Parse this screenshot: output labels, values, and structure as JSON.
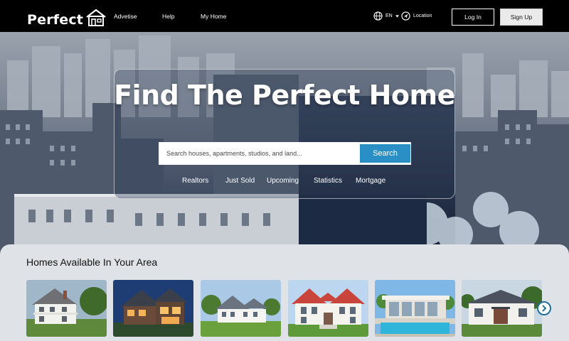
{
  "navbar": {
    "logo_text": "Perfect",
    "links": {
      "advertise": "Advetise",
      "help": "Help",
      "my_home": "My Home"
    },
    "language": "EN",
    "location": "Location",
    "login": "Log In",
    "signup": "Sign Up"
  },
  "hero": {
    "title": "Find The Perfect Home",
    "search_placeholder": "Search houses, apartments, studios, and land...",
    "search_button": "Search",
    "quick_links": {
      "realtors": "Realtors",
      "just_sold": "Just Sold",
      "upcoming": "Upcoming",
      "statistics": "Statistics",
      "mortgage": "Mortgage"
    }
  },
  "listings": {
    "title": "Homes Available In Your Area"
  },
  "colors": {
    "accent": "#2a8fc4",
    "navbar": "#000000",
    "section_bg": "#dfe3e7"
  }
}
